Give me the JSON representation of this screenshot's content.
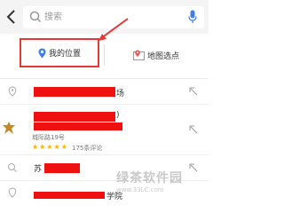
{
  "search": {
    "placeholder": "搜索"
  },
  "quick_actions": {
    "my_location": "我的位置",
    "map_pick": "地图选点"
  },
  "list": {
    "row1_suffix": "场",
    "row2_suffix": ")",
    "row2_address": "城际路19号",
    "row2_reviews": "175条评论",
    "row3_prefix": "苏",
    "row4_suffix": "学院"
  },
  "rating": {
    "stars_filled": 5,
    "stars_total": 5
  },
  "watermark": {
    "title": "绿茶软件园",
    "url": "www.33LC.com"
  },
  "colors": {
    "accent_blue": "#3d7fe6",
    "annotation_red": "#e53935",
    "redaction_red": "#ef1010"
  }
}
